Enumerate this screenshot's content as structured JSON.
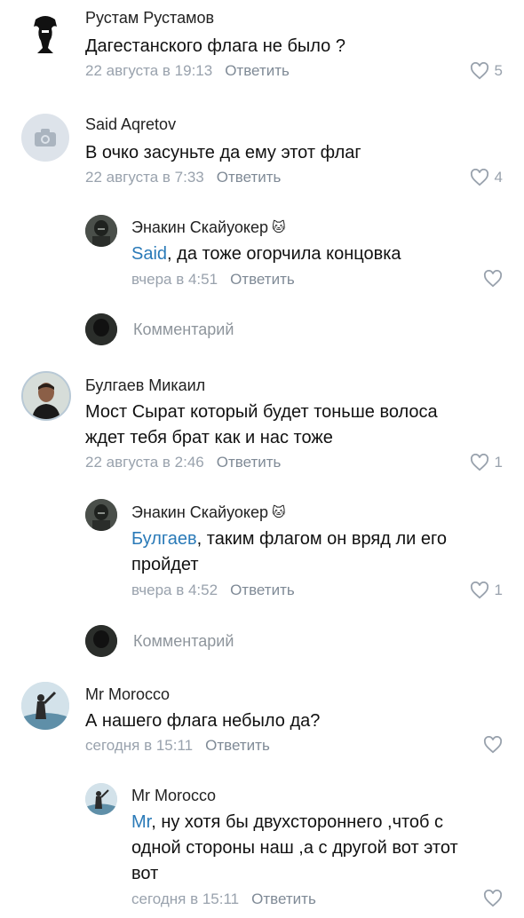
{
  "comments": [
    {
      "author": "Рустам Рустамов",
      "text": "Дагестанского флага не было ?",
      "date": "22 августа в 19:13",
      "reply_label": "Ответить",
      "likes": "5"
    },
    {
      "author": "Said Aqretov",
      "text": "В очко засуньте да ему этот флаг",
      "date": "22 августа в 7:33",
      "reply_label": "Ответить",
      "likes": "4",
      "replies": [
        {
          "author": "Энакин Скайуокер",
          "author_emoji": "🐱",
          "mention": "Said",
          "text": ", да тоже огорчила концовка",
          "date": "вчера в 4:51",
          "reply_label": "Ответить",
          "likes": ""
        }
      ],
      "add_comment_placeholder": "Комментарий"
    },
    {
      "author": "Булгаев Микаил",
      "text_line1": "Мост Сырат который будет тоньше волоса",
      "text_line2": "ждет тебя брат как и нас тоже",
      "date": "22 августа в 2:46",
      "reply_label": "Ответить",
      "likes": "1",
      "replies": [
        {
          "author": "Энакин Скайуокер",
          "author_emoji": "🐱",
          "mention": "Булгаев",
          "text_line1": ", таким флагом он вряд ли его",
          "text_line2": "пройдет",
          "date": "вчера в 4:52",
          "reply_label": "Ответить",
          "likes": "1"
        }
      ],
      "add_comment_placeholder": "Комментарий"
    },
    {
      "author": "Mr Morocco",
      "text": "А нашего флага небыло да?",
      "date": "сегодня в 15:11",
      "reply_label": "Ответить",
      "likes": "",
      "replies": [
        {
          "author": "Mr Morocco",
          "mention": "Mr",
          "text_line1": ", ну хотя бы двухстороннего ,чтоб с",
          "text_line2": "одной стороны наш ,а с другой вот этот",
          "text_line3": "вот",
          "date": "сегодня в 15:11",
          "reply_label": "Ответить",
          "likes": ""
        }
      ]
    }
  ],
  "icons": {
    "like": "heart-outline-icon",
    "camera": "camera-icon"
  },
  "colors": {
    "mention": "#2a7ab8",
    "meta": "#99a2ad",
    "placeholder_avatar": "#dde3ea"
  }
}
